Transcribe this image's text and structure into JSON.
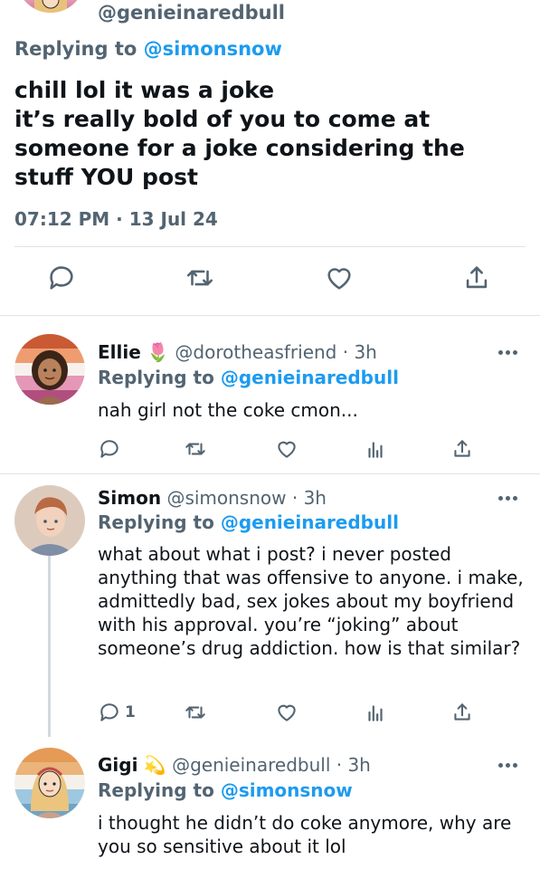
{
  "main_tweet": {
    "handle": "@genieinaredbull",
    "replying_prefix": "Replying to ",
    "replying_to": "@simonsnow",
    "text": "chill lol it was a joke\nit’s really bold of you to come at someone for a joke considering the stuff YOU post",
    "timestamp": "07:12 PM · 13 Jul 24",
    "actions": [
      "reply-icon",
      "retweet-icon",
      "like-icon",
      "share-icon"
    ]
  },
  "replies": [
    {
      "name": "Ellie",
      "name_emoji": "🌷",
      "handle_time": "@dorotheasfriend · 3h",
      "replying_prefix": "Replying to ",
      "replying_to": "@genieinaredbull",
      "text": "nah girl not the coke cmon...",
      "reply_count": "",
      "avatar_colors": [
        "#d2663a",
        "#f0a47a",
        "#f8f2ef",
        "#e79aba",
        "#b3507f"
      ]
    },
    {
      "name": "Simon",
      "handle_time": "@simonsnow · 3h",
      "replying_prefix": "Replying to ",
      "replying_to": "@genieinaredbull",
      "text": "what about what i post? i never posted anything that was offensive to anyone. i make, admittedly bad, sex jokes about my boyfriend with his approval. you’re “joking” about someone’s drug addiction. how is that similar?",
      "reply_count": "1",
      "avatar_colors": [
        "#d8c7b9",
        "#b97450",
        "#7e8da3"
      ]
    },
    {
      "name": "Gigi",
      "name_emoji": "💫",
      "handle_time": "@genieinaredbull · 3h",
      "replying_prefix": "Replying to ",
      "replying_to": "@simonsnow",
      "text": "i thought he didn’t do coke anymore, why are you so sensitive about it lol",
      "reply_count": "",
      "avatar_colors": [
        "#e8a05e",
        "#f3f0ea",
        "#d6739a"
      ]
    }
  ],
  "colors": {
    "accent": "#1d9bf0",
    "muted": "#536471",
    "text": "#0f1419",
    "divider": "#dfe3e6"
  }
}
